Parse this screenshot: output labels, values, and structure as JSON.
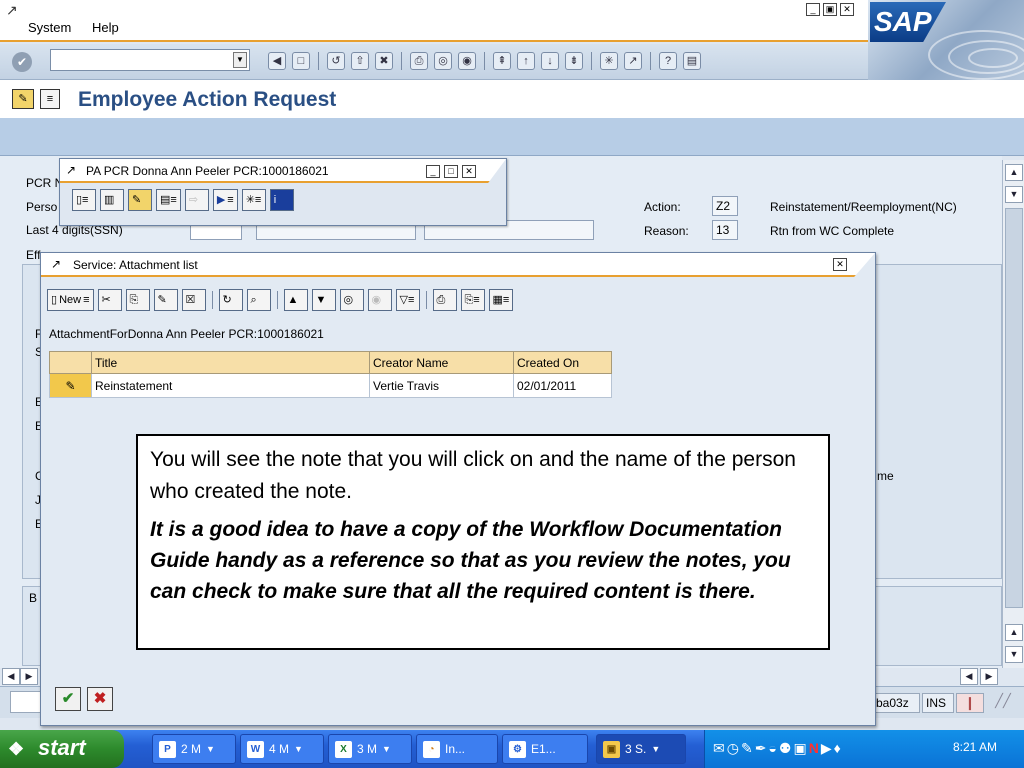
{
  "menubar": {
    "system": "System",
    "help": "Help"
  },
  "window_controls": [
    "minimize-icon",
    "restore-icon",
    "close-icon"
  ],
  "brand": {
    "logo": "SAP"
  },
  "toolbar": {
    "command_value": "",
    "icons": [
      "back-icon",
      "save-icon",
      "back-nav-icon",
      "exit-icon",
      "cancel-icon",
      "print-icon",
      "find-icon",
      "find-next-icon",
      "first-page-icon",
      "prev-page-icon",
      "next-page-icon",
      "last-page-icon",
      "new-session-icon",
      "shortcut-icon",
      "help-icon",
      "layout-icon"
    ]
  },
  "page": {
    "title": "Employee Action Request"
  },
  "form": {
    "pcr_label": "PCR N",
    "person_label": "Perso",
    "ssn_label": "Last 4 digits(SSN)",
    "eff_label": "Eff",
    "action_label": "Action:",
    "action_code": "Z2",
    "action_text": "Reinstatement/Reemployment(NC)",
    "reason_label": "Reason:",
    "reason_code": "13",
    "reason_text": "Rtn from WC Complete",
    "side_labels": [
      "F",
      "S",
      "E",
      "E",
      "C",
      "J",
      "E"
    ],
    "me_fragment": "me",
    "bottom_label": "B"
  },
  "pcr_popup": {
    "title": "PA PCR Donna Ann Peeler PCR:1000186021",
    "icons": [
      "document-icon",
      "menu-icon",
      "trash-icon",
      "edit-icon",
      "save-icon",
      "dropdown-icon",
      "flow-icon",
      "dropdown-icon",
      "play-icon",
      "dropdown-icon",
      "spark-icon",
      "dropdown-icon",
      "info-icon"
    ]
  },
  "attachment_popup": {
    "title": "Service: Attachment list",
    "new_label": "New",
    "caption": "AttachmentForDonna Ann Peeler PCR:1000186021",
    "columns": [
      "Title",
      "Creator Name",
      "Created On"
    ],
    "rows": [
      {
        "title": "Reinstatement",
        "creator": "Vertie Travis",
        "created_on": "02/01/2011"
      }
    ]
  },
  "callout": {
    "line1": "You will see the note that you will click on and the name of the person who created the note.",
    "line2": "It is a good idea to have a copy of the Workflow Documentation Guide handy as a reference so that as you review the notes, you can check to make sure that all the required content is there."
  },
  "status": {
    "server": "ba03z",
    "mode": "INS"
  },
  "taskbar": {
    "start": "start",
    "tasks": [
      {
        "label": "2 M",
        "icon": "presentation-icon"
      },
      {
        "label": "4 M",
        "icon": "word-icon"
      },
      {
        "label": "3 M",
        "icon": "excel-icon"
      },
      {
        "label": "In...",
        "icon": "browser-icon"
      },
      {
        "label": "E1...",
        "icon": "sap-icon"
      },
      {
        "label": "3 S.",
        "icon": "folder-icon"
      }
    ],
    "clock": "8:21 AM"
  },
  "colors": {
    "accent": "#e8a030",
    "title": "#2a4f84",
    "taskbar": "#245fd4"
  }
}
